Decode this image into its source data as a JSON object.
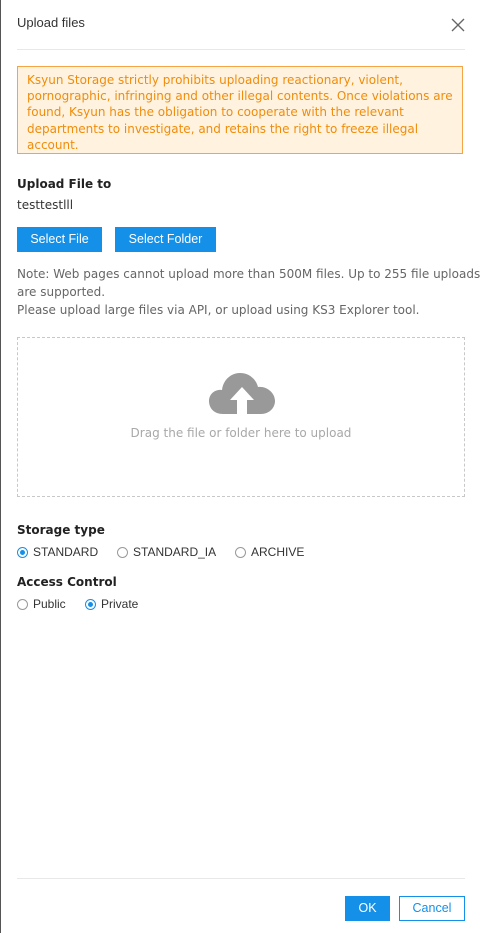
{
  "dialog": {
    "title": "Upload files",
    "close_icon": "close-icon"
  },
  "warning": {
    "text": "Ksyun Storage strictly prohibits uploading reactionary, violent, pornographic, infringing and other illegal contents. Once violations are found, Ksyun has the obligation to cooperate with the relevant departments to investigate, and retains the right to freeze illegal account.",
    "color": "#f08c0a",
    "background": "#fff3e0",
    "border": "#f5a546"
  },
  "upload_to": {
    "label": "Upload File to",
    "path": "testtestlll"
  },
  "buttons": {
    "select_file": "Select File",
    "select_folder": "Select Folder",
    "ok": "OK",
    "cancel": "Cancel"
  },
  "note": {
    "line1": "Note: Web pages cannot upload more than 500M files. Up to 255 file uploads",
    "line2": "are supported.",
    "line3": "Please upload large files via API, or upload using KS3 Explorer tool."
  },
  "dropzone": {
    "icon": "cloud-upload-icon",
    "text": "Drag the file or folder here to upload"
  },
  "storage_type": {
    "label": "Storage type",
    "options": [
      {
        "label": "STANDARD",
        "checked": true
      },
      {
        "label": "STANDARD_IA",
        "checked": false
      },
      {
        "label": "ARCHIVE",
        "checked": false
      }
    ]
  },
  "access_control": {
    "label": "Access Control",
    "options": [
      {
        "label": "Public",
        "checked": false
      },
      {
        "label": "Private",
        "checked": true
      }
    ]
  },
  "colors": {
    "accent": "#1590e8",
    "text": "#333333",
    "muted": "#666666"
  }
}
